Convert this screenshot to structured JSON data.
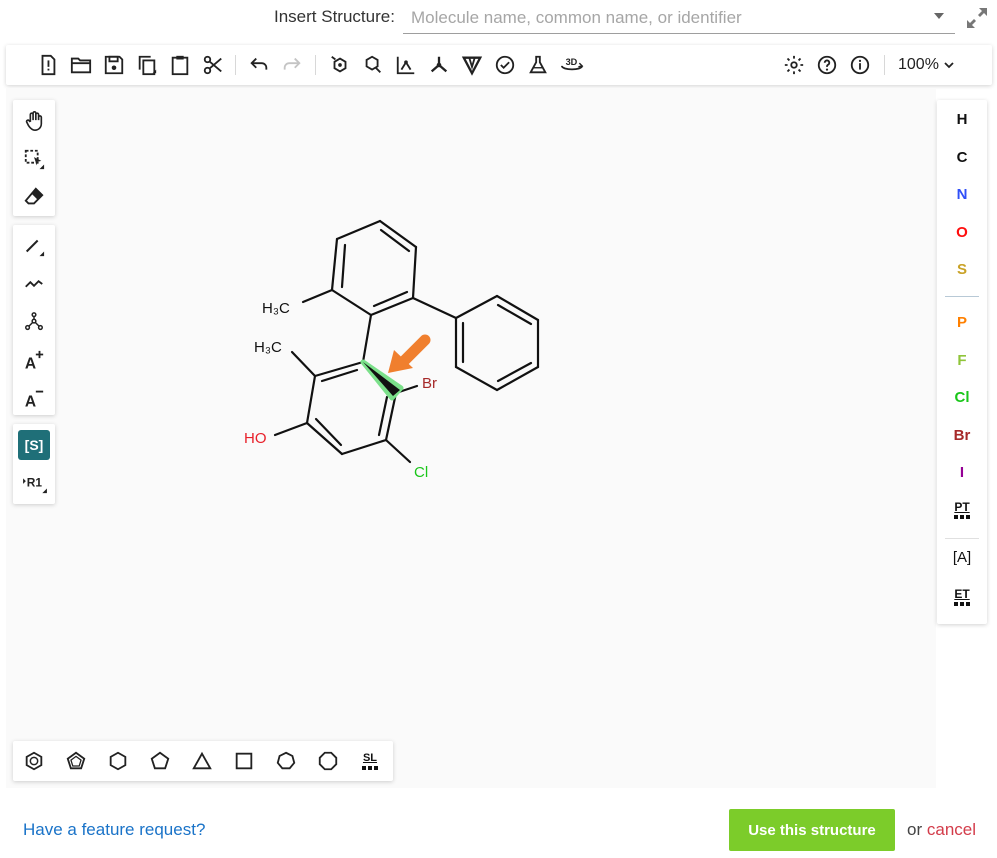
{
  "insert": {
    "label": "Insert Structure:",
    "placeholder": "Molecule name, common name, or identifier"
  },
  "toolbar": {
    "zoom": "100%",
    "three_d_label": "3D"
  },
  "left_tools": {
    "sgroup_label": "[S]",
    "rgroup_label": "R1",
    "add_charge": "A",
    "remove_charge": "A"
  },
  "elements": [
    {
      "symbol": "H",
      "color": "#111111"
    },
    {
      "symbol": "C",
      "color": "#111111"
    },
    {
      "symbol": "N",
      "color": "#3050f8"
    },
    {
      "symbol": "O",
      "color": "#ff0d0d"
    },
    {
      "symbol": "S",
      "color": "#c9a227"
    },
    {
      "symbol": "P",
      "color": "#ff8000"
    },
    {
      "symbol": "F",
      "color": "#8fc43a"
    },
    {
      "symbol": "Cl",
      "color": "#1ac61a"
    },
    {
      "symbol": "Br",
      "color": "#a62929"
    },
    {
      "symbol": "I",
      "color": "#940094"
    }
  ],
  "extra_tools": {
    "periodic_table": "PT",
    "atom_text": "A",
    "extended_table": "ET",
    "shape_library": "SL"
  },
  "molecule": {
    "labels": {
      "methyl1": "H3C",
      "methyl2": "H3C",
      "hydroxyl": "HO",
      "bromine": "Br",
      "chlorine": "Cl"
    },
    "colors": {
      "hydroxyl": "#e8202a",
      "bromine": "#a62929",
      "chlorine": "#1ac61a",
      "highlight": "#7be08a",
      "arrow": "#f07f2e"
    }
  },
  "footer": {
    "feature_request": "Have a feature request?",
    "use_structure": "Use this structure",
    "or": "or",
    "cancel": "cancel"
  }
}
